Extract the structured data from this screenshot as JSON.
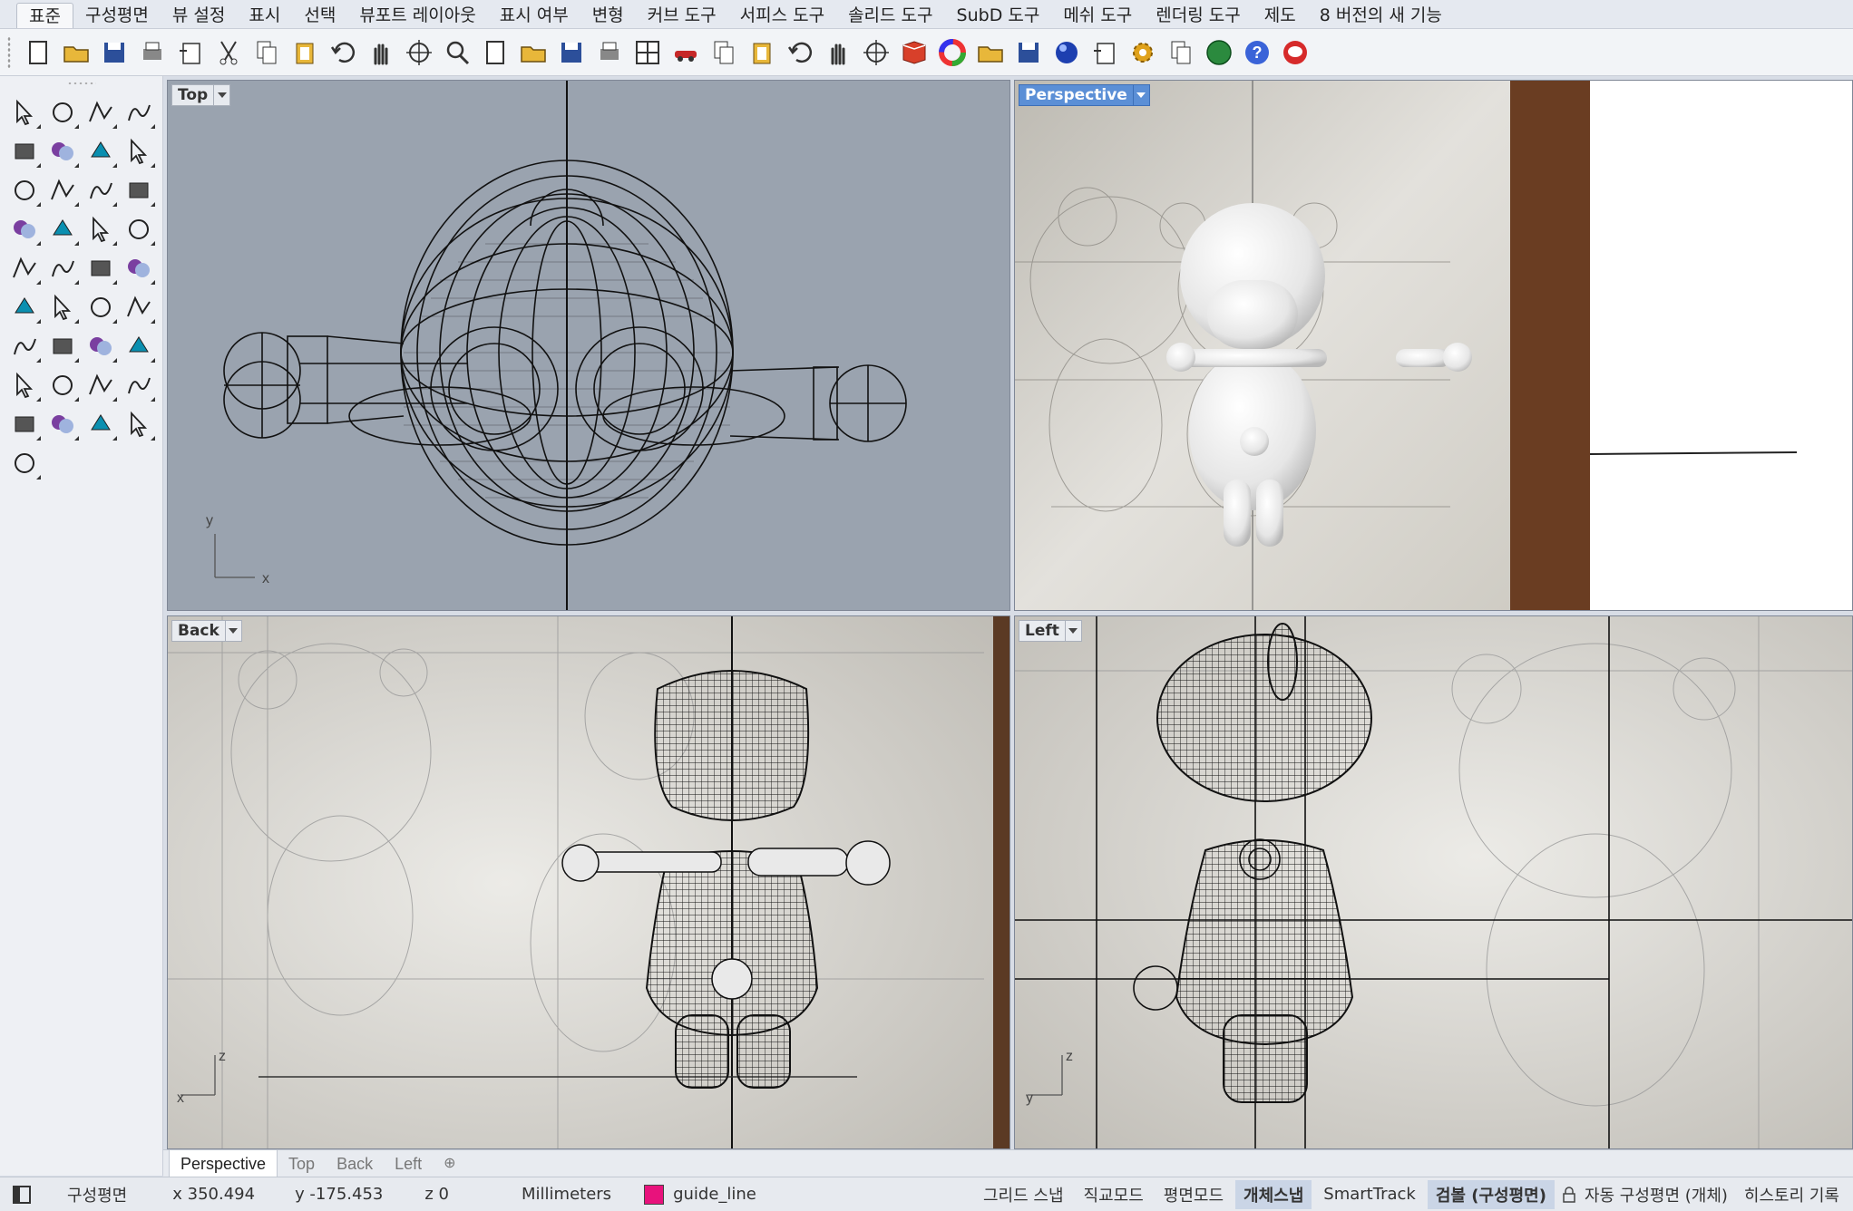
{
  "menu": {
    "tabs": [
      "표준",
      "구성평면",
      "뷰 설정",
      "표시",
      "선택",
      "뷰포트 레이아웃",
      "표시 여부",
      "변형",
      "커브 도구",
      "서피스 도구",
      "솔리드 도구",
      "SubD 도구",
      "메쉬 도구",
      "렌더링 도구",
      "제도",
      "8 버전의 새 기능"
    ],
    "active": "표준"
  },
  "toolbar_icons": [
    "new-file-icon",
    "open-folder-icon",
    "save-icon",
    "print-icon",
    "import-icon",
    "cut-icon",
    "copy-icon",
    "paste-icon",
    "undo-icon",
    "pan-hand-icon",
    "rotate-view-icon",
    "zoom-icon",
    "zoom-window-icon",
    "zoom-extents-icon",
    "zoom-selected-icon",
    "undo-view-icon",
    "four-viewports-icon",
    "car-icon",
    "grid-plane-icon",
    "circle-target-icon",
    "shapes-icon",
    "light-bulb-icon",
    "lock-icon",
    "layer-book-icon",
    "color-wheel-icon",
    "wireframe-sphere-icon",
    "ghosted-sphere-icon",
    "rendered-sphere-icon",
    "pen-highlighter-icon",
    "gear-icon",
    "dimension-icon",
    "globe-icon",
    "help-icon",
    "chat-icon"
  ],
  "viewports": {
    "top": {
      "label": "Top",
      "axis_x": "x",
      "axis_y": "y"
    },
    "perspective": {
      "label": "Perspective"
    },
    "back": {
      "label": "Back",
      "axis_x": "x",
      "axis_y": "z"
    },
    "left": {
      "label": "Left",
      "axis_x": "y",
      "axis_y": "z"
    }
  },
  "viewport_tabs": [
    "Perspective",
    "Top",
    "Back",
    "Left"
  ],
  "viewport_tab_active": "Perspective",
  "viewport_tab_add": "⊕",
  "status": {
    "cplane": "구성평면",
    "x": "x 350.494",
    "y": "y -175.453",
    "z": "z 0",
    "units": "Millimeters",
    "layer": "guide_line",
    "layer_color": "#e8127c",
    "buttons": [
      {
        "label": "그리드 스냅",
        "on": false
      },
      {
        "label": "직교모드",
        "on": false
      },
      {
        "label": "평면모드",
        "on": false
      },
      {
        "label": "개체스냅",
        "on": true
      },
      {
        "label": "SmartTrack",
        "on": false
      },
      {
        "label": "검볼 (구성평면)",
        "on": true
      }
    ],
    "auto_cplane": "자동 구성평면 (개체)",
    "history": "히스토리 기록"
  },
  "colors": {
    "top_bg": "#9aa3af",
    "active_label": "#5b8fd6"
  }
}
